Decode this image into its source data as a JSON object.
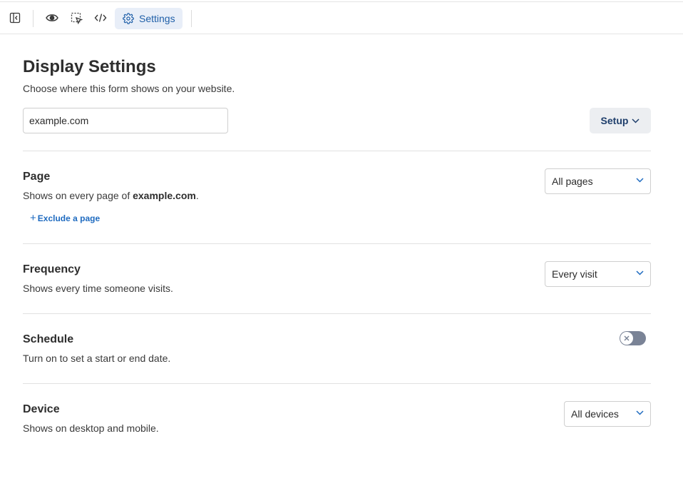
{
  "toolbar": {
    "settings_label": "Settings"
  },
  "header": {
    "title": "Display Settings",
    "subtitle": "Choose where this form shows on your website."
  },
  "domain": {
    "value": "example.com",
    "setup_label": "Setup"
  },
  "page_section": {
    "title": "Page",
    "desc_prefix": "Shows on every page of ",
    "desc_domain": "example.com",
    "desc_suffix": ".",
    "select_value": "All pages",
    "exclude_label": "Exclude a page"
  },
  "frequency_section": {
    "title": "Frequency",
    "desc": "Shows every time someone visits.",
    "select_value": "Every visit"
  },
  "schedule_section": {
    "title": "Schedule",
    "desc": "Turn on to set a start or end date.",
    "toggle_on": false
  },
  "device_section": {
    "title": "Device",
    "desc": "Shows on desktop and mobile.",
    "select_value": "All devices"
  },
  "colors": {
    "accent": "#1f6bc0",
    "tab_bg": "#e8eef8",
    "toggle_off": "#7a8396"
  }
}
